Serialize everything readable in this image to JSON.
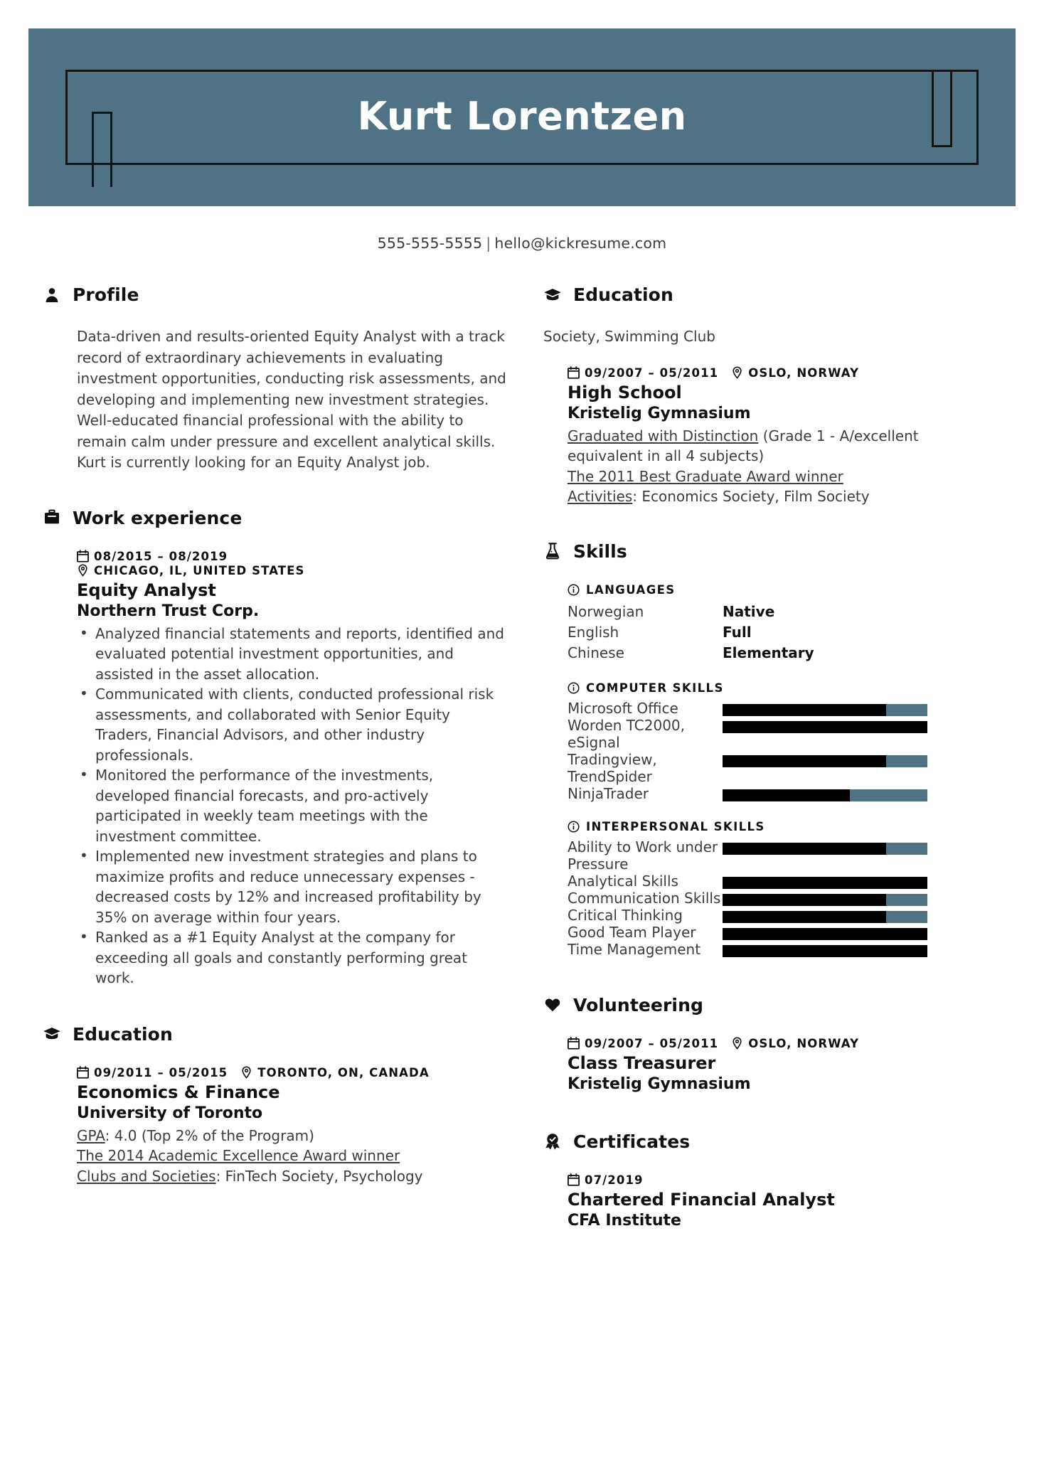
{
  "header": {
    "full_name": "Kurt Lorentzen",
    "accent_color": "#4f7284",
    "phone": "555-555-5555",
    "separator": "|",
    "email": "hello@kickresume.com"
  },
  "left_column": {
    "profile": {
      "heading": "Profile",
      "icon": "person-icon",
      "text": "Data-driven and results-oriented Equity Analyst with a track record of extraordinary achievements in evaluating investment opportunities, conducting risk assessments, and developing and implementing new investment strategies. Well-educated financial professional with the ability to remain calm under pressure and excellent analytical skills. Kurt is currently looking for an Equity Analyst job."
    },
    "work_experience": {
      "heading": "Work experience",
      "icon": "briefcase-icon",
      "entries": [
        {
          "date": "08/2015 – 08/2019",
          "location": "CHICAGO, IL, UNITED STATES",
          "title": "Equity Analyst",
          "organization": "Northern Trust Corp.",
          "bullets": [
            "Analyzed financial statements and reports, identified and evaluated potential investment opportunities, and assisted in the asset allocation.",
            "Communicated with clients, conducted professional risk assessments, and collaborated with Senior Equity Traders, Financial Advisors, and other industry professionals.",
            "Monitored the performance of the investments, developed financial forecasts, and pro-actively participated in weekly team meetings with the investment committee.",
            "Implemented new investment strategies and plans to maximize profits and reduce unnecessary expenses - decreased costs by 12% and increased profitability by 35% on average within four years.",
            "Ranked as a #1 Equity Analyst at the company for exceeding all goals and constantly performing great work."
          ]
        }
      ]
    },
    "education": {
      "heading": "Education",
      "icon": "graduation-cap-icon",
      "entries": [
        {
          "date": "09/2011 – 05/2015",
          "location": "TORONTO, ON, CANADA",
          "title": "Economics & Finance",
          "organization": "University of Toronto",
          "lines": [
            {
              "underlined": "GPA",
              "rest": ": 4.0 (Top 2% of the Program)"
            },
            {
              "underlined": "The 2014 Academic Excellence Award winner",
              "rest": ""
            },
            {
              "underlined": "Clubs and Societies",
              "rest": ": FinTech Society, Psychology"
            }
          ]
        }
      ]
    }
  },
  "right_column": {
    "education": {
      "heading": "Education",
      "icon": "graduation-cap-icon",
      "continuation_text": "Society, Swimming Club",
      "entries": [
        {
          "date": "09/2007 – 05/2011",
          "location": "OSLO, NORWAY",
          "title": "High School",
          "organization": "Kristelig Gymnasium",
          "lines": [
            {
              "underlined": "Graduated with Distinction",
              "rest": " (Grade 1 - A/excellent equivalent in all 4 subjects)"
            },
            {
              "underlined": "The 2011 Best Graduate Award winner",
              "rest": ""
            },
            {
              "underlined": "Activities",
              "rest": ": Economics Society, Film Society"
            }
          ]
        }
      ]
    },
    "skills": {
      "heading": "Skills",
      "icon": "flask-icon",
      "groups": [
        {
          "title": "LANGUAGES",
          "icon": "info-icon",
          "type": "languages",
          "items": [
            {
              "name": "Norwegian",
              "level": "Native"
            },
            {
              "name": "English",
              "level": "Full"
            },
            {
              "name": "Chinese",
              "level": "Elementary"
            }
          ]
        },
        {
          "title": "COMPUTER SKILLS",
          "icon": "info-icon",
          "type": "bars",
          "items": [
            {
              "label": "Microsoft Office",
              "lines": [
                "Microsoft Office"
              ],
              "value": 80
            },
            {
              "label": "Worden TC2000, eSignal",
              "lines": [
                "Worden TC2000,",
                "eSignal"
              ],
              "value": 100
            },
            {
              "label": "Tradingview, TrendSpider",
              "lines": [
                "Tradingview,",
                "TrendSpider"
              ],
              "value": 80
            },
            {
              "label": "NinjaTrader",
              "lines": [
                "NinjaTrader"
              ],
              "value": 62
            }
          ]
        },
        {
          "title": "INTERPERSONAL SKILLS",
          "icon": "info-icon",
          "type": "bars",
          "items": [
            {
              "label": "Ability to Work under Pressure",
              "lines": [
                "Ability to Work under",
                "Pressure"
              ],
              "value": 80
            },
            {
              "label": "Analytical Skills",
              "lines": [
                "Analytical Skills"
              ],
              "value": 100
            },
            {
              "label": "Communication Skills",
              "lines": [
                "Communication Skills"
              ],
              "value": 80
            },
            {
              "label": "Critical Thinking",
              "lines": [
                "Critical Thinking"
              ],
              "value": 80
            },
            {
              "label": "Good Team Player",
              "lines": [
                "Good Team Player"
              ],
              "value": 100
            },
            {
              "label": "Time Management",
              "lines": [
                "Time Management"
              ],
              "value": 100
            }
          ]
        }
      ]
    },
    "volunteering": {
      "heading": "Volunteering",
      "icon": "heart-icon",
      "entries": [
        {
          "date": "09/2007 – 05/2011",
          "location": "OSLO, NORWAY",
          "title": "Class Treasurer",
          "organization": "Kristelig Gymnasium"
        }
      ]
    },
    "certificates": {
      "heading": "Certificates",
      "icon": "award-badge-icon",
      "entries": [
        {
          "date": "07/2019",
          "title": "Chartered Financial Analyst",
          "organization": "CFA Institute"
        }
      ]
    }
  }
}
